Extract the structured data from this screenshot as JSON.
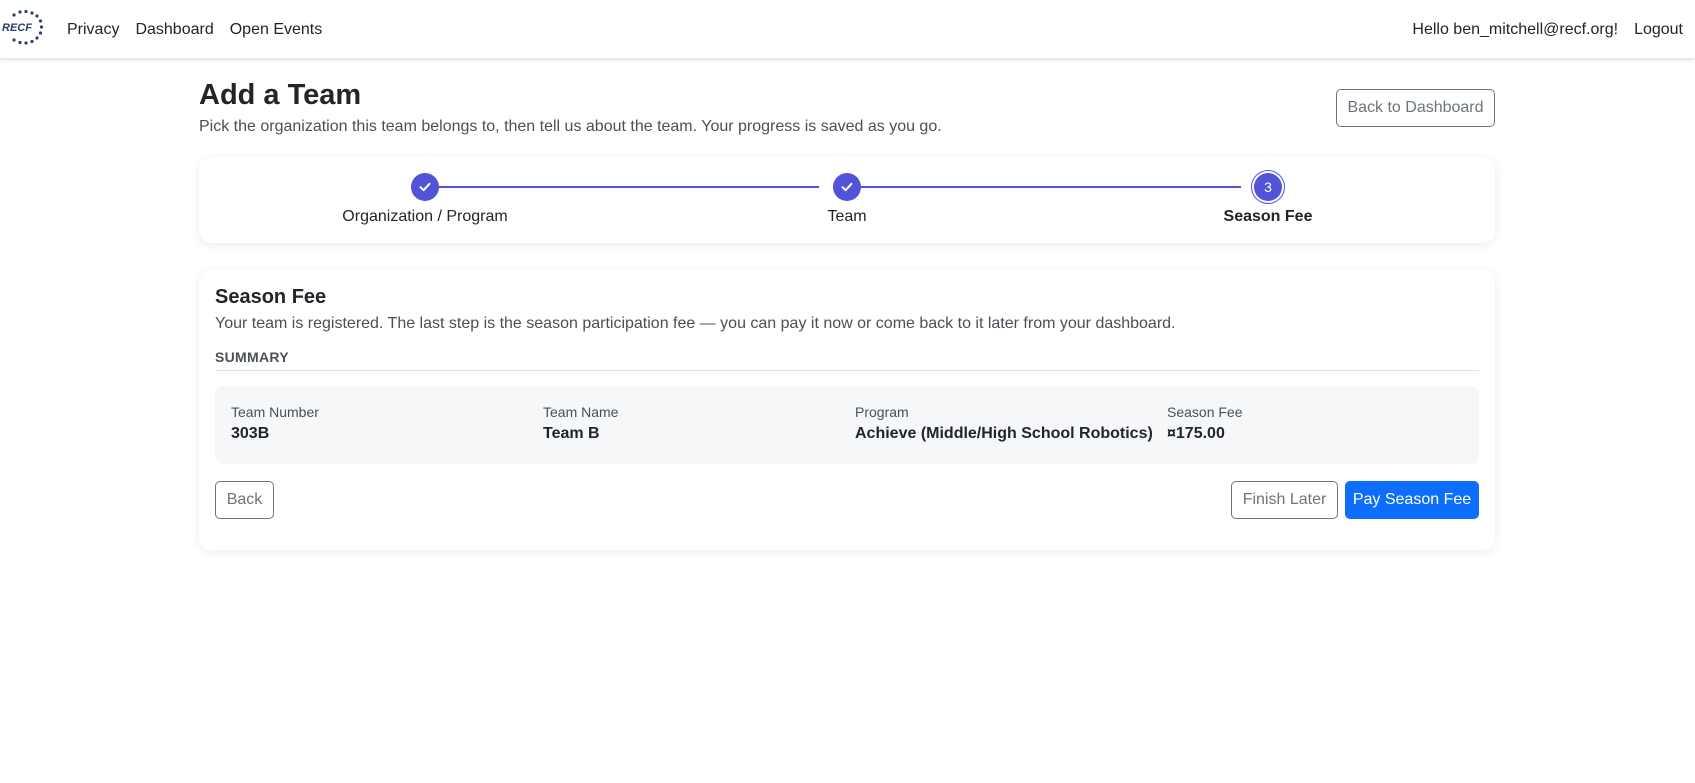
{
  "nav": {
    "logo_text": "RECF",
    "links": [
      "Privacy",
      "Dashboard",
      "Open Events"
    ],
    "greeting": "Hello ben_mitchell@recf.org!",
    "logout": "Logout"
  },
  "header": {
    "title": "Add a Team",
    "subtitle": "Pick the organization this team belongs to, then tell us about the team. Your progress is saved as you go.",
    "back_to_dashboard": "Back to Dashboard"
  },
  "stepper": {
    "steps": [
      {
        "label": "Organization / Program",
        "status": "complete",
        "icon": "check-icon"
      },
      {
        "label": "Team",
        "status": "complete",
        "icon": "check-icon"
      },
      {
        "label": "Season Fee",
        "status": "current",
        "number": "3"
      }
    ],
    "accent_color": "#5154d9"
  },
  "season_fee": {
    "title": "Season Fee",
    "description": "Your team is registered. The last step is the season participation fee — you can pay it now or come back to it later from your dashboard.",
    "summary_heading": "SUMMARY",
    "summary": [
      {
        "label": "Team Number",
        "value": "303B"
      },
      {
        "label": "Team Name",
        "value": "Team B"
      },
      {
        "label": "Program",
        "value": "Achieve (Middle/High School Robotics)"
      },
      {
        "label": "Season Fee",
        "value": "¤175.00"
      }
    ],
    "back_button": "Back",
    "finish_later_button": "Finish Later",
    "pay_button": "Pay Season Fee",
    "primary_color": "#0d6efd"
  }
}
